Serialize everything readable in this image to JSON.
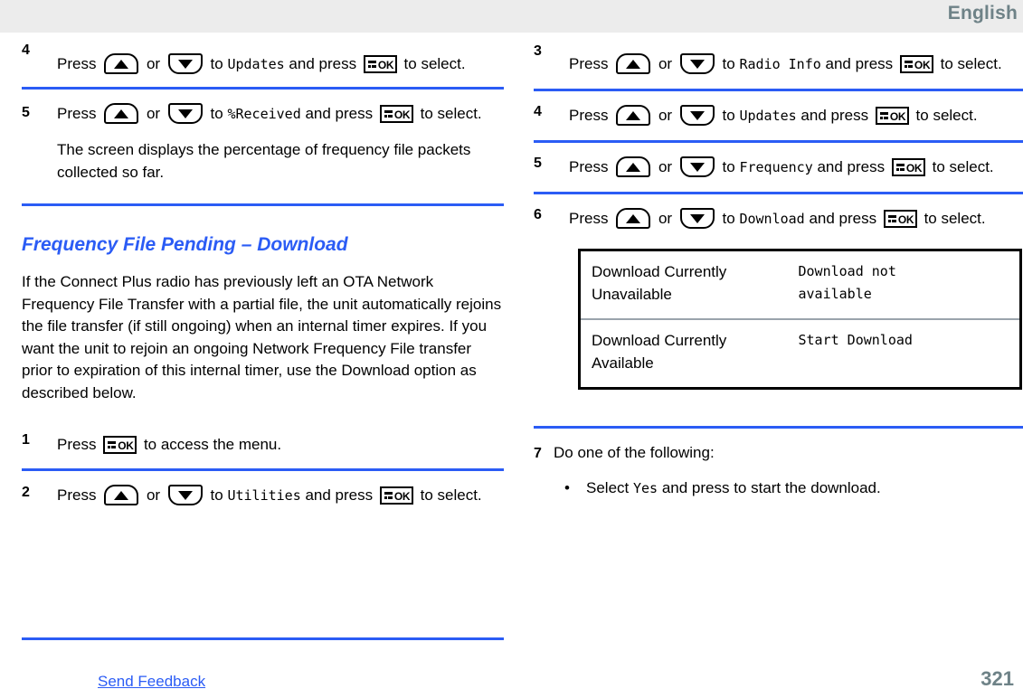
{
  "header": {
    "language_label": "English"
  },
  "icons": {
    "up_key": "arrow-up-key-icon",
    "down_key": "arrow-down-key-icon",
    "ok_key": "menu-ok-key-icon",
    "ok_text": "OK"
  },
  "left_column": {
    "steps": [
      {
        "number": "4",
        "parts": {
          "t1": "Press",
          "t2": "or",
          "t3": "to",
          "mono": "Updates",
          "t4": "and press",
          "t5": "to select."
        }
      },
      {
        "number": "5",
        "parts": {
          "t1": "Press",
          "t2": "or",
          "t3": "to",
          "mono": "%Received",
          "t4": "and press",
          "t5": "to select."
        },
        "note": "The screen displays the percentage of frequency file packets collected so far."
      }
    ],
    "section": {
      "heading": "Frequency File Pending – Download",
      "paragraph": "If the Connect Plus radio has previously left an OTA Network Frequency File Transfer with a partial file, the unit automatically rejoins the file transfer (if still ongoing) when an internal timer expires. If you want the unit to rejoin an ongoing Network Frequency File transfer prior to expiration of this internal timer, use the Download option as described below."
    },
    "steps2": [
      {
        "number": "1",
        "parts": {
          "t1": "Press",
          "t5": "to access the menu."
        }
      },
      {
        "number": "2",
        "parts": {
          "t1": "Press",
          "t2": "or",
          "t3": "to",
          "mono": "Utilities",
          "t4": "and press",
          "t5": "to select."
        }
      }
    ]
  },
  "right_column": {
    "steps": [
      {
        "number": "3",
        "parts": {
          "t1": "Press",
          "t2": "or",
          "t3": "to",
          "mono": "Radio Info",
          "t4": "and press",
          "t5": "to select."
        }
      },
      {
        "number": "4",
        "parts": {
          "t1": "Press",
          "t2": "or",
          "t3": "to",
          "mono": "Updates",
          "t4": "and press",
          "t5": "to select."
        }
      },
      {
        "number": "5",
        "parts": {
          "t1": "Press",
          "t2": "or",
          "t3": "to",
          "mono": "Frequency",
          "t4": "and press",
          "t5": "to select."
        }
      },
      {
        "number": "6",
        "parts": {
          "t1": "Press",
          "t2": "or",
          "t3": "to",
          "mono": "Download",
          "t4": "and press",
          "t5": "to select."
        }
      }
    ],
    "table": {
      "rows": [
        {
          "condition": "Download Currently Unavailable",
          "display_line1": "Download not",
          "display_line2": "available"
        },
        {
          "condition": "Download Currently Available",
          "display_line1": "Start Download",
          "display_line2": ""
        }
      ]
    },
    "step7": {
      "number": "7",
      "text": "Do one of the following:",
      "bullet": {
        "dot": "•",
        "pre": "Select",
        "mono": "Yes",
        "post": "and press to start the download."
      }
    }
  },
  "footer": {
    "send_feedback": "Send Feedback",
    "page_number": "321"
  },
  "colors": {
    "accent_blue": "#2b5cf5",
    "header_gray_text": "#6e8287",
    "header_band": "#ececec"
  }
}
